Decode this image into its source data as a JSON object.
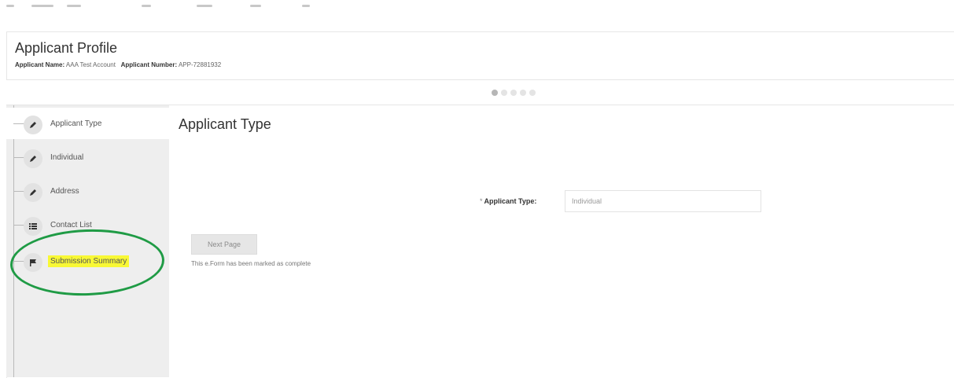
{
  "profile": {
    "title": "Applicant Profile",
    "name_label": "Applicant Name:",
    "name_value": "AAA Test Account",
    "number_label": "Applicant Number:",
    "number_value": "APP-72881932"
  },
  "progress": {
    "total_steps": 5,
    "current_step": 1
  },
  "sidebar": {
    "items": [
      {
        "label": "Applicant Type",
        "icon": "pencil-icon"
      },
      {
        "label": "Individual",
        "icon": "pencil-icon"
      },
      {
        "label": "Address",
        "icon": "pencil-icon"
      },
      {
        "label": "Contact List",
        "icon": "list-icon"
      },
      {
        "label": "Submission Summary",
        "icon": "flag-icon"
      }
    ]
  },
  "main": {
    "title": "Applicant Type",
    "field": {
      "required_mark": "*",
      "label": "Applicant Type:",
      "value": "Individual"
    },
    "next_button": "Next Page",
    "complete_message": "This e.Form has been marked as complete"
  },
  "colors": {
    "highlight": "#f8f835",
    "annotation_ring": "#1f9b45",
    "sidebar_bg": "#eeeeee"
  }
}
